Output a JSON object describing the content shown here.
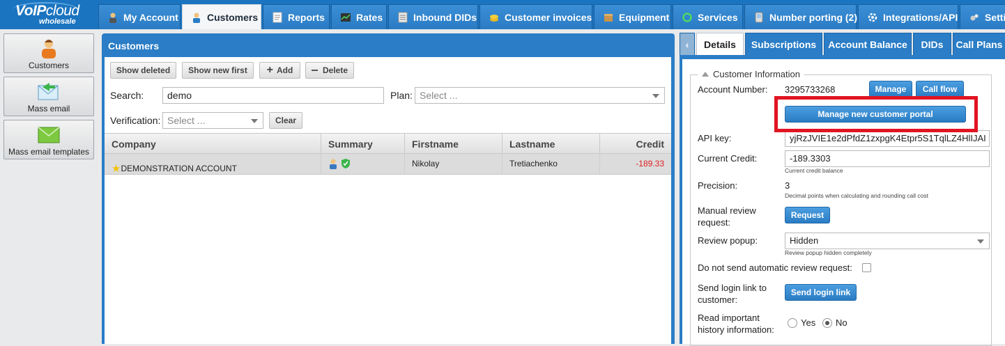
{
  "logo": {
    "brand": "VoIP",
    "brand2": "cloud",
    "sub": "wholesale"
  },
  "nav": [
    {
      "label": "My Account",
      "icon": "user-icon"
    },
    {
      "label": "Customers",
      "icon": "user-icon"
    },
    {
      "label": "Reports",
      "icon": "report-icon"
    },
    {
      "label": "Rates",
      "icon": "chart-icon"
    },
    {
      "label": "Inbound DIDs",
      "icon": "list-icon"
    },
    {
      "label": "Customer invoices",
      "icon": "coins-icon"
    },
    {
      "label": "Equipment",
      "icon": "box-icon"
    },
    {
      "label": "Services",
      "icon": "refresh-icon"
    },
    {
      "label": "Number porting (2)",
      "icon": "phone-icon"
    },
    {
      "label": "Integrations/API",
      "icon": "gear-icon"
    },
    {
      "label": "Setti",
      "icon": "gears-icon"
    }
  ],
  "sidebar": [
    {
      "label": "Customers",
      "icon": "customer-icon"
    },
    {
      "label": "Mass email",
      "icon": "mass-email-icon"
    },
    {
      "label": "Mass email templates",
      "icon": "email-template-icon"
    }
  ],
  "customers": {
    "title": "Customers",
    "toolbar": {
      "show_deleted": "Show deleted",
      "show_new_first": "Show new first",
      "add": "Add",
      "delete": "Delete"
    },
    "search_label": "Search:",
    "search_value": "demo",
    "plan_label": "Plan:",
    "plan_placeholder": "Select ...",
    "verification_label": "Verification:",
    "verification_placeholder": "Select ...",
    "clear": "Clear",
    "columns": [
      "Company",
      "Summary",
      "Firstname",
      "Lastname",
      "Credit"
    ],
    "rows": [
      {
        "company": "DEMONSTRATION ACCOUNT",
        "firstname": "Nikolay",
        "lastname": "Tretiachenko",
        "credit": "-189.33"
      }
    ]
  },
  "details": {
    "tabs": [
      "Details",
      "Subscriptions",
      "Account Balance",
      "DIDs",
      "Call Plans"
    ],
    "legend": "Customer Information",
    "account_number_label": "Account Number:",
    "account_number": "3295733268",
    "manage": "Manage",
    "call_flow": "Call flow",
    "manage_portal": "Manage new customer portal",
    "api_key_label": "API key:",
    "api_key": "yjRzJVIE1e2dPfdZ1zxpgK4Etpr5S1TqlLZ4HlIJAI",
    "current_credit_label": "Current Credit:",
    "current_credit": "-189.3303",
    "current_credit_hint": "Current credit balance",
    "precision_label": "Precision:",
    "precision": "3",
    "precision_hint": "Decimal points when calculating and rounding call cost",
    "manual_review_label_1": "Manual review",
    "manual_review_label_2": "request:",
    "request": "Request",
    "review_popup_label": "Review popup:",
    "review_popup": "Hidden",
    "review_popup_hint": "Review popup hidden completely",
    "no_auto_review_label": "Do not send automatic review request:",
    "send_login_label_1": "Send login link to",
    "send_login_label_2": "customer:",
    "send_login": "Send login link",
    "read_history_label_1": "Read important",
    "read_history_label_2": "history information:",
    "yes": "Yes",
    "no": "No"
  },
  "colors": {
    "nav_blue": "#1b74c0",
    "panel_blue": "#2a7dc6",
    "highlight_red": "#e11422",
    "credit_red": "#e02020"
  }
}
